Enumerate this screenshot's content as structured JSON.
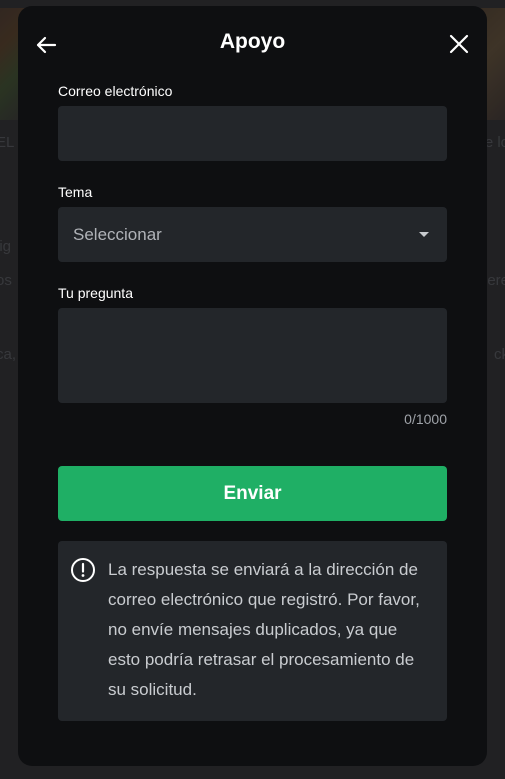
{
  "modal": {
    "title": "Apoyo",
    "back_icon": "arrow-left-icon",
    "close_icon": "close-icon"
  },
  "form": {
    "email": {
      "label": "Correo electrónico",
      "value": ""
    },
    "topic": {
      "label": "Tema",
      "selected": "Seleccionar",
      "icon": "caret-down-icon"
    },
    "question": {
      "label": "Tu pregunta",
      "value": "",
      "counter": "0/1000"
    },
    "submit_label": "Enviar"
  },
  "notice": {
    "icon": "info-circle-icon",
    "text": "La respuesta se enviará a la dirección de correo electrónico que registró. Por favor, no envíe mensajes duplicados, ya que esto podría retrasar el procesamiento de su solicitud."
  },
  "colors": {
    "modal_bg": "#0e0f11",
    "field_bg": "#23262a",
    "accent_green": "#1faf65"
  }
}
